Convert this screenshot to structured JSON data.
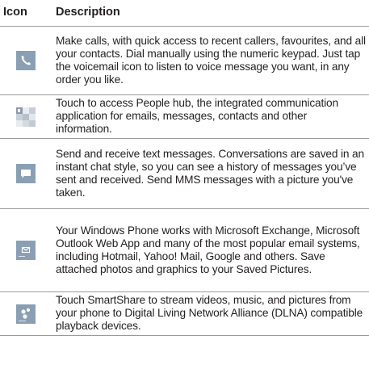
{
  "header": {
    "icon": "Icon",
    "description": "Description"
  },
  "rows": [
    {
      "icon": "phone-icon",
      "text": "Make calls, with quick access to recent callers, favourites, and all your contacts. Dial manually using the numeric keypad. Just tap the voicemail icon to listen to voice message you want, in any order you like."
    },
    {
      "icon": "people-hub-icon",
      "text": "Touch to access People hub, the integrated communication application for emails, messages, contacts and other information."
    },
    {
      "icon": "messaging-icon",
      "text": "Send and receive text messages. Conversations are saved in an instant chat style, so you can see a history of messages you’ve sent and received. Send MMS messages with a picture you've taken."
    },
    {
      "icon": "email-icon",
      "text": "Your Windows Phone works with Microsoft Exchange, Microsoft Outlook Web App and many of the most popular email systems, including Hotmail, Yahoo! Mail, Google and others. Save attached photos and graphics to your Saved Pictures."
    },
    {
      "icon": "smartshare-icon",
      "text": "Touch SmartShare to stream videos, music, and pictures from your phone to Digital Living Network Alliance (DLNA) compatible playback devices."
    }
  ]
}
